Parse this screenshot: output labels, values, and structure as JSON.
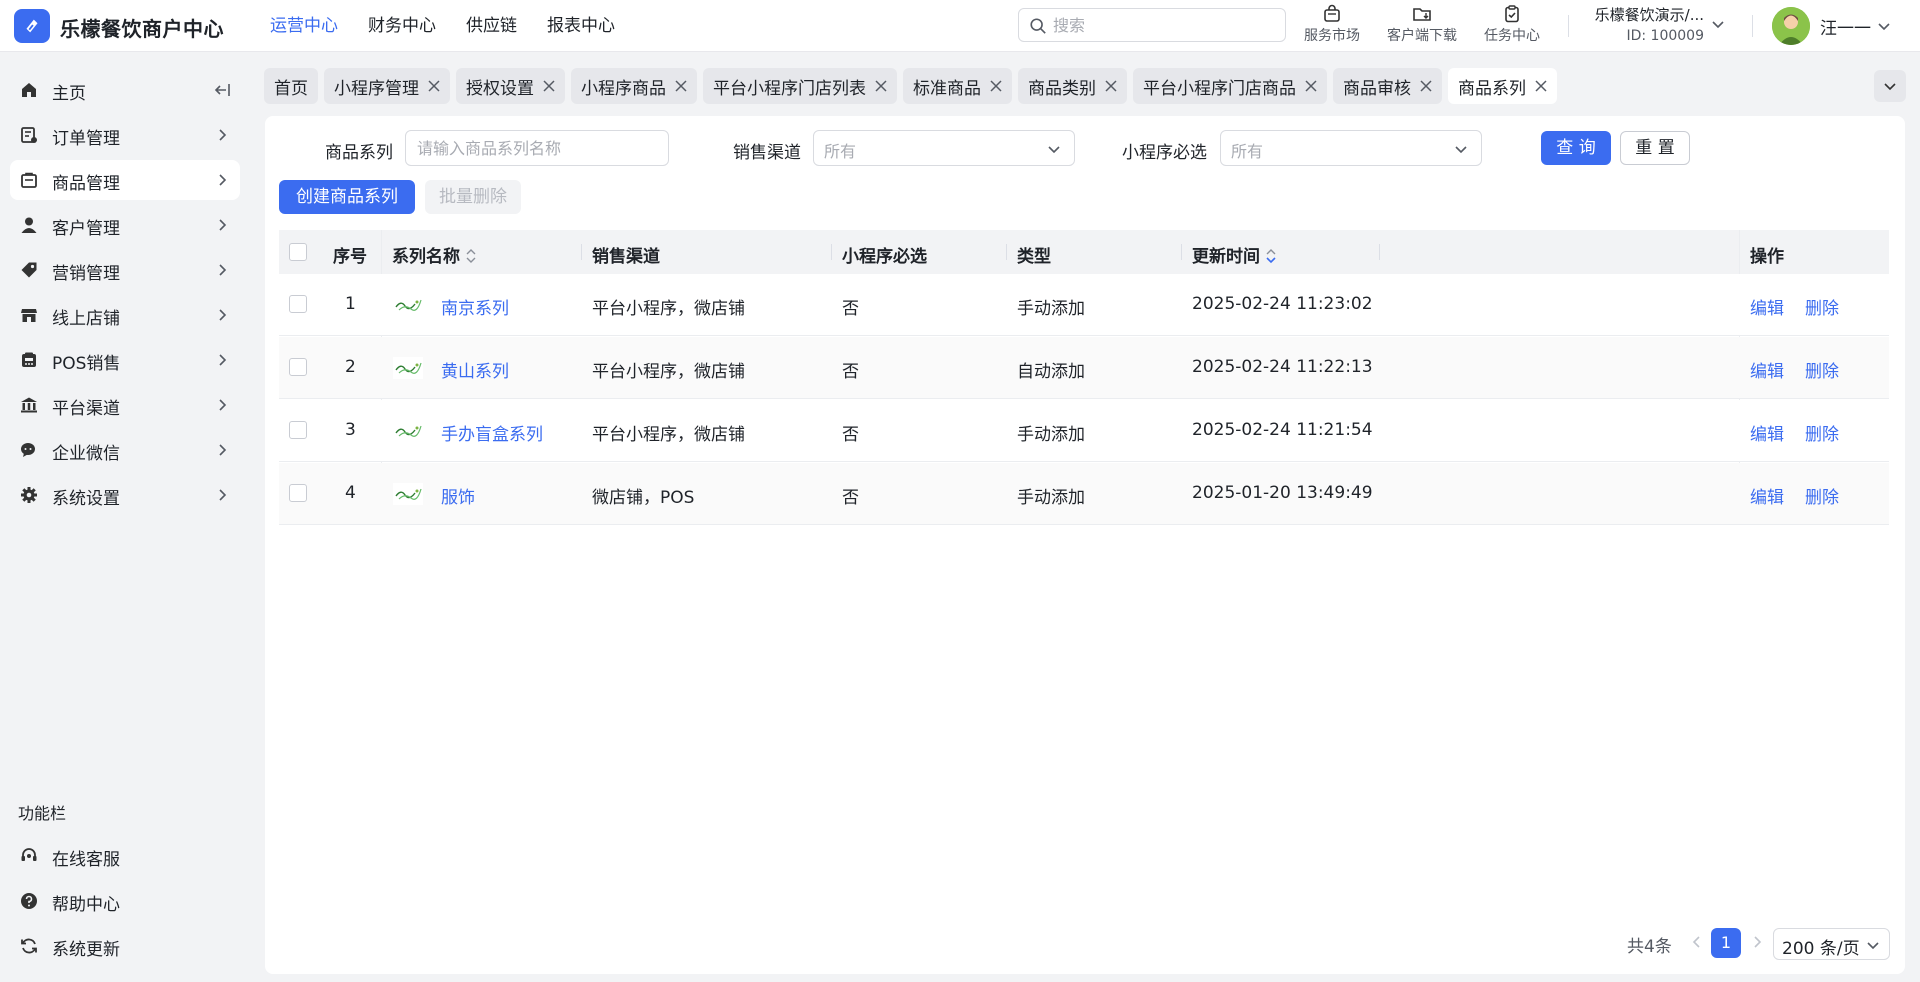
{
  "header": {
    "brand": "乐檬餐饮商户中心",
    "nav": [
      "运营中心",
      "财务中心",
      "供应链",
      "报表中心"
    ],
    "search_placeholder": "搜索",
    "tools": {
      "market": "服务市场",
      "download": "客户端下载",
      "tasks": "任务中心"
    },
    "shop_name": "乐檬餐饮演示/...",
    "shop_id": "ID: 100009",
    "user_name": "汪一一"
  },
  "sidebar": {
    "items": [
      {
        "label": "主页",
        "icon": "home-icon"
      },
      {
        "label": "订单管理",
        "icon": "order-icon"
      },
      {
        "label": "商品管理",
        "icon": "product-icon"
      },
      {
        "label": "客户管理",
        "icon": "user-icon"
      },
      {
        "label": "营销管理",
        "icon": "tag-icon"
      },
      {
        "label": "线上店铺",
        "icon": "store-icon"
      },
      {
        "label": "POS销售",
        "icon": "pos-icon"
      },
      {
        "label": "平台渠道",
        "icon": "bank-icon"
      },
      {
        "label": "企业微信",
        "icon": "wechat-icon"
      },
      {
        "label": "系统设置",
        "icon": "gear-icon"
      }
    ],
    "function_title": "功能栏",
    "function_items": [
      {
        "label": "在线客服",
        "icon": "headset-icon"
      },
      {
        "label": "帮助中心",
        "icon": "help-icon"
      },
      {
        "label": "系统更新",
        "icon": "refresh-icon"
      }
    ]
  },
  "tabs": [
    "首页",
    "小程序管理",
    "授权设置",
    "小程序商品",
    "平台小程序门店列表",
    "标准商品",
    "商品类别",
    "平台小程序门店商品",
    "商品审核",
    "商品系列"
  ],
  "filters": {
    "series_label": "商品系列",
    "series_placeholder": "请输入商品系列名称",
    "channel_label": "销售渠道",
    "channel_value": "所有",
    "required_label": "小程序必选",
    "required_value": "所有",
    "query_btn": "查 询",
    "reset_btn": "重 置"
  },
  "actions": {
    "create": "创建商品系列",
    "batch_delete": "批量删除"
  },
  "table": {
    "headers": {
      "index": "序号",
      "name": "系列名称",
      "channel": "销售渠道",
      "required": "小程序必选",
      "type": "类型",
      "updated": "更新时间",
      "ops": "操作"
    },
    "rows": [
      {
        "index": "1",
        "name": "南京系列",
        "channel": "平台小程序，微店铺",
        "required": "否",
        "type": "手动添加",
        "updated": "2025-02-24 11:23:02",
        "edit": "编辑",
        "delete": "删除"
      },
      {
        "index": "2",
        "name": "黄山系列",
        "channel": "平台小程序，微店铺",
        "required": "否",
        "type": "自动添加",
        "updated": "2025-02-24 11:22:13",
        "edit": "编辑",
        "delete": "删除"
      },
      {
        "index": "3",
        "name": "手办盲盒系列",
        "channel": "平台小程序，微店铺",
        "required": "否",
        "type": "手动添加",
        "updated": "2025-02-24 11:21:54",
        "edit": "编辑",
        "delete": "删除"
      },
      {
        "index": "4",
        "name": "服饰",
        "channel": "微店铺，POS",
        "required": "否",
        "type": "手动添加",
        "updated": "2025-01-20 13:49:49",
        "edit": "编辑",
        "delete": "删除"
      }
    ]
  },
  "pagination": {
    "total": "共4条",
    "current": "1",
    "page_size": "200 条/页"
  },
  "colors": {
    "primary": "#3b6cf0",
    "sidebar_bg": "#f2f3f5",
    "header_bg": "#ffffff"
  }
}
